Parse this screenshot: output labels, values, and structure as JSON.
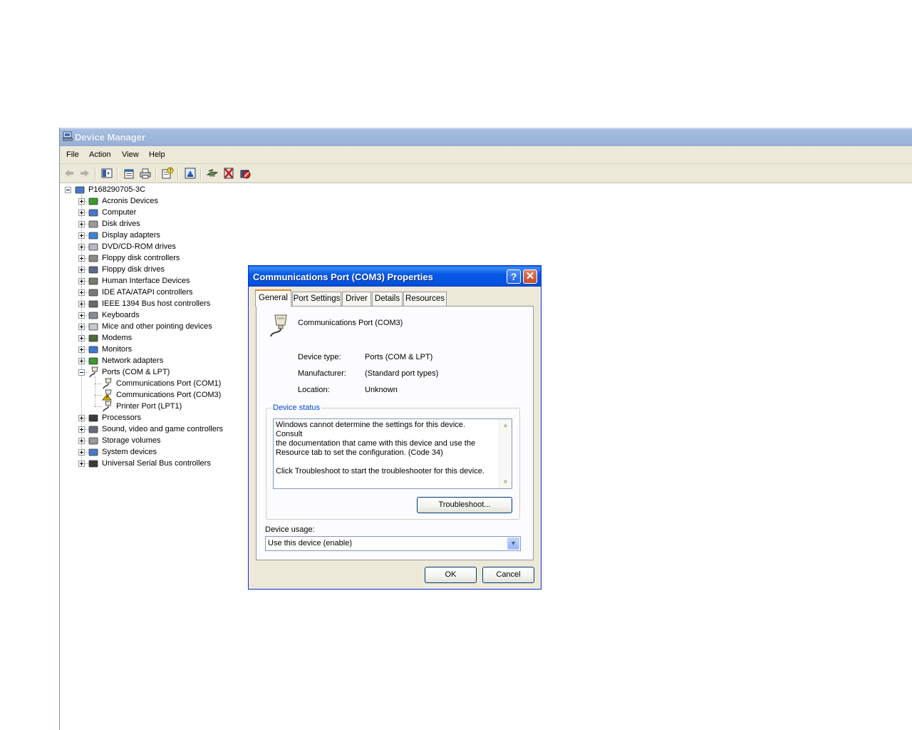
{
  "device_manager": {
    "title": "Device Manager",
    "menu": [
      "File",
      "Action",
      "View",
      "Help"
    ],
    "toolbar_icons": [
      "back-arrow-icon",
      "forward-arrow-icon",
      "show-hide-console-tree-icon",
      "properties-icon",
      "print-icon",
      "help-icon",
      "update-driver-icon",
      "scan-hardware-icon",
      "uninstall-icon",
      "disable-icon"
    ],
    "tree": {
      "root": "P168290705-3C",
      "categories": [
        {
          "label": "Acronis Devices",
          "icon": "board-icon"
        },
        {
          "label": "Computer",
          "icon": "computer-icon"
        },
        {
          "label": "Disk drives",
          "icon": "disk-drive-icon"
        },
        {
          "label": "Display adapters",
          "icon": "display-adapter-icon"
        },
        {
          "label": "DVD/CD-ROM drives",
          "icon": "cdrom-icon"
        },
        {
          "label": "Floppy disk controllers",
          "icon": "floppy-controller-icon"
        },
        {
          "label": "Floppy disk drives",
          "icon": "floppy-drive-icon"
        },
        {
          "label": "Human Interface Devices",
          "icon": "hid-icon"
        },
        {
          "label": "IDE ATA/ATAPI controllers",
          "icon": "ide-controller-icon"
        },
        {
          "label": "IEEE 1394 Bus host controllers",
          "icon": "ieee1394-icon"
        },
        {
          "label": "Keyboards",
          "icon": "keyboard-icon"
        },
        {
          "label": "Mice and other pointing devices",
          "icon": "mouse-icon"
        },
        {
          "label": "Modems",
          "icon": "modem-icon"
        },
        {
          "label": "Monitors",
          "icon": "monitor-icon"
        },
        {
          "label": "Network adapters",
          "icon": "network-adapter-icon"
        },
        {
          "label": "Ports (COM & LPT)",
          "icon": "port-icon",
          "expanded": true,
          "children": [
            {
              "label": "Communications Port (COM1)",
              "icon": "port-icon"
            },
            {
              "label": "Communications Port (COM3)",
              "icon": "port-warning-icon"
            },
            {
              "label": "Printer Port (LPT1)",
              "icon": "port-icon"
            }
          ]
        },
        {
          "label": "Processors",
          "icon": "processor-icon"
        },
        {
          "label": "Sound, video and game controllers",
          "icon": "sound-icon"
        },
        {
          "label": "Storage volumes",
          "icon": "storage-volume-icon"
        },
        {
          "label": "System devices",
          "icon": "system-device-icon"
        },
        {
          "label": "Universal Serial Bus controllers",
          "icon": "usb-icon"
        }
      ]
    }
  },
  "dialog": {
    "title": "Communications Port (COM3) Properties",
    "tabs": [
      "General",
      "Port Settings",
      "Driver",
      "Details",
      "Resources"
    ],
    "active_tab": "General",
    "device_name": "Communications Port (COM3)",
    "device_type_label": "Device type:",
    "device_type_value": "Ports (COM & LPT)",
    "manufacturer_label": "Manufacturer:",
    "manufacturer_value": "(Standard port types)",
    "location_label": "Location:",
    "location_value": "Unknown",
    "device_status_label": "Device status",
    "device_status_text": "Windows cannot determine the settings for this device.  Consult\nthe documentation that came with this device and use the\nResource tab to set the configuration. (Code 34)\n\nClick Troubleshoot to start the troubleshooter for this device.",
    "troubleshoot_label": "Troubleshoot...",
    "device_usage_label": "Device usage:",
    "device_usage_value": "Use this device (enable)",
    "ok_label": "OK",
    "cancel_label": "Cancel",
    "help_glyph": "?",
    "close_glyph": "✕"
  }
}
